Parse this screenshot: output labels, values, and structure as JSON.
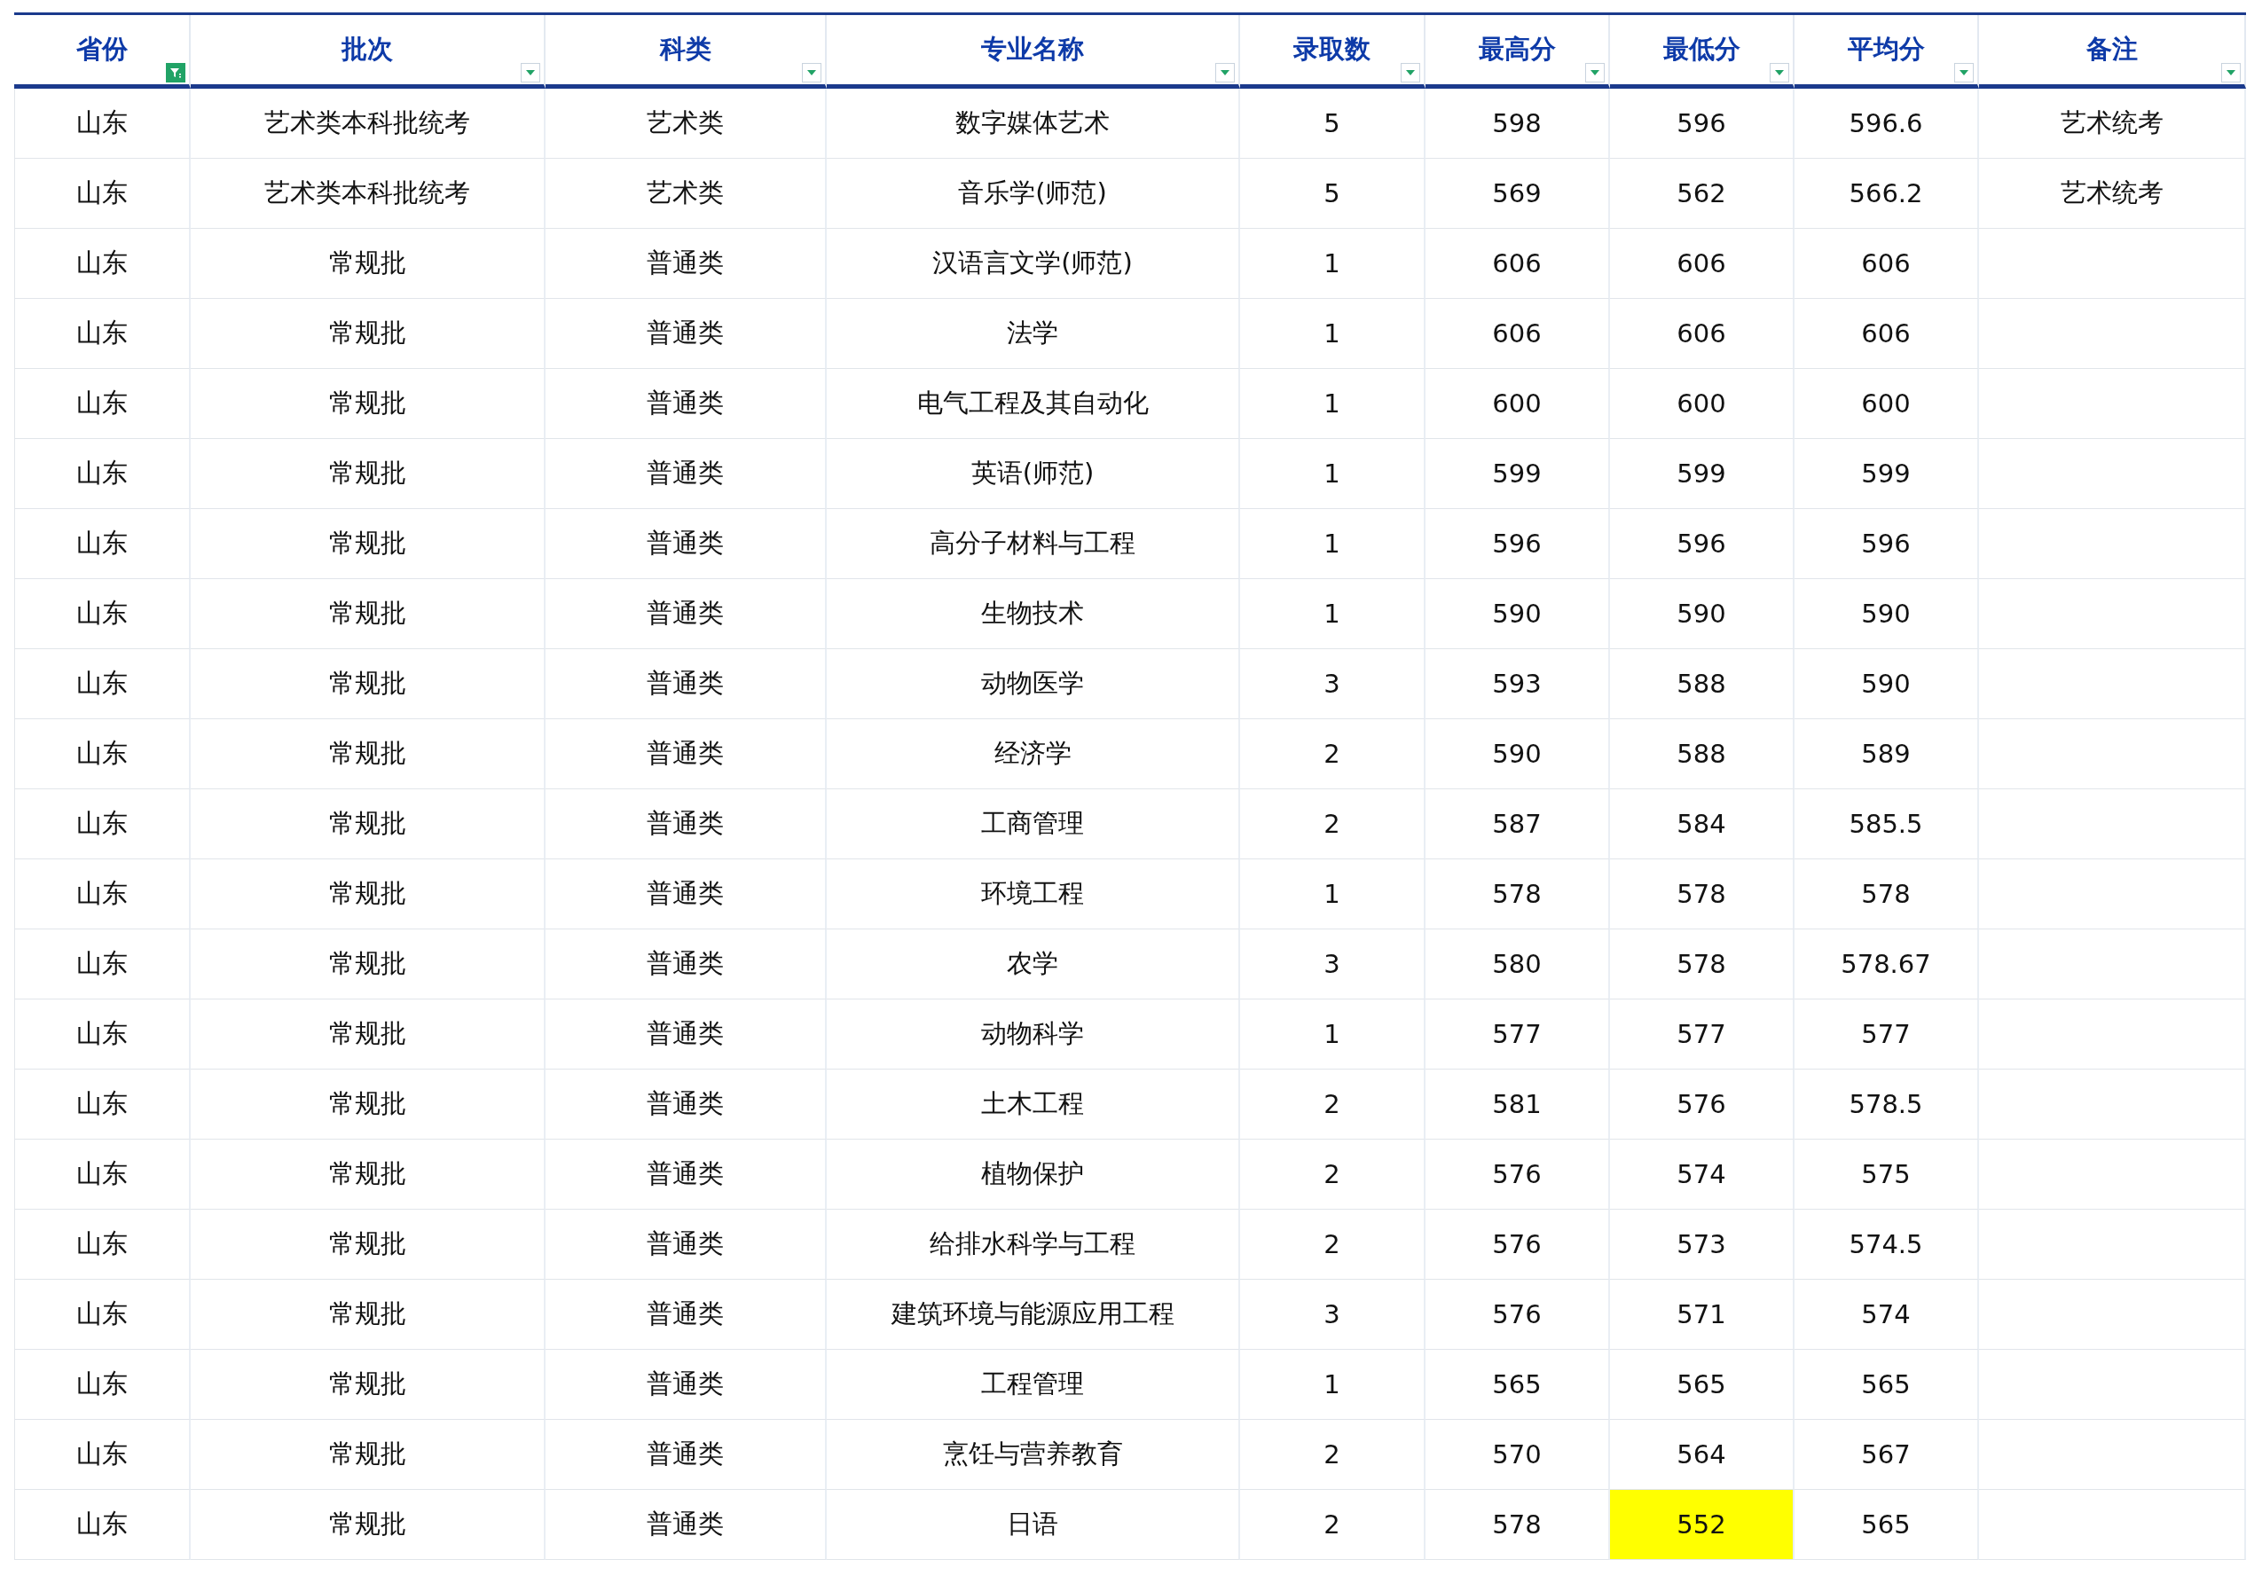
{
  "columns": [
    {
      "label": "省份",
      "filtered": true
    },
    {
      "label": "批次",
      "filtered": false
    },
    {
      "label": "科类",
      "filtered": false
    },
    {
      "label": "专业名称",
      "filtered": false
    },
    {
      "label": "录取数",
      "filtered": false
    },
    {
      "label": "最高分",
      "filtered": false
    },
    {
      "label": "最低分",
      "filtered": false
    },
    {
      "label": "平均分",
      "filtered": false
    },
    {
      "label": "备注",
      "filtered": false
    }
  ],
  "rows": [
    {
      "cells": [
        {
          "text": "山东",
          "highlighted": false
        },
        {
          "text": "艺术类本科批统考",
          "highlighted": false
        },
        {
          "text": "艺术类",
          "highlighted": false
        },
        {
          "text": "数字媒体艺术",
          "highlighted": false
        },
        {
          "text": "5",
          "highlighted": false
        },
        {
          "text": "598",
          "highlighted": false
        },
        {
          "text": "596",
          "highlighted": false
        },
        {
          "text": "596.6",
          "highlighted": false
        },
        {
          "text": "艺术统考",
          "highlighted": false
        }
      ]
    },
    {
      "cells": [
        {
          "text": "山东",
          "highlighted": false
        },
        {
          "text": "艺术类本科批统考",
          "highlighted": false
        },
        {
          "text": "艺术类",
          "highlighted": false
        },
        {
          "text": "音乐学(师范)",
          "highlighted": false
        },
        {
          "text": "5",
          "highlighted": false
        },
        {
          "text": "569",
          "highlighted": false
        },
        {
          "text": "562",
          "highlighted": false
        },
        {
          "text": "566.2",
          "highlighted": false
        },
        {
          "text": "艺术统考",
          "highlighted": false
        }
      ]
    },
    {
      "cells": [
        {
          "text": "山东",
          "highlighted": false
        },
        {
          "text": "常规批",
          "highlighted": false
        },
        {
          "text": "普通类",
          "highlighted": false
        },
        {
          "text": "汉语言文学(师范)",
          "highlighted": false
        },
        {
          "text": "1",
          "highlighted": false
        },
        {
          "text": "606",
          "highlighted": false
        },
        {
          "text": "606",
          "highlighted": false
        },
        {
          "text": "606",
          "highlighted": false
        }
      ]
    },
    {
      "cells": [
        {
          "text": "山东",
          "highlighted": false
        },
        {
          "text": "常规批",
          "highlighted": false
        },
        {
          "text": "普通类",
          "highlighted": false
        },
        {
          "text": "法学",
          "highlighted": false
        },
        {
          "text": "1",
          "highlighted": false
        },
        {
          "text": "606",
          "highlighted": false
        },
        {
          "text": "606",
          "highlighted": false
        },
        {
          "text": "606",
          "highlighted": false
        }
      ]
    },
    {
      "cells": [
        {
          "text": "山东",
          "highlighted": false
        },
        {
          "text": "常规批",
          "highlighted": false
        },
        {
          "text": "普通类",
          "highlighted": false
        },
        {
          "text": "电气工程及其自动化",
          "highlighted": false
        },
        {
          "text": "1",
          "highlighted": false
        },
        {
          "text": "600",
          "highlighted": false
        },
        {
          "text": "600",
          "highlighted": false
        },
        {
          "text": "600",
          "highlighted": false
        }
      ]
    },
    {
      "cells": [
        {
          "text": "山东",
          "highlighted": false
        },
        {
          "text": "常规批",
          "highlighted": false
        },
        {
          "text": "普通类",
          "highlighted": false
        },
        {
          "text": "英语(师范)",
          "highlighted": false
        },
        {
          "text": "1",
          "highlighted": false
        },
        {
          "text": "599",
          "highlighted": false
        },
        {
          "text": "599",
          "highlighted": false
        },
        {
          "text": "599",
          "highlighted": false
        }
      ]
    },
    {
      "cells": [
        {
          "text": "山东",
          "highlighted": false
        },
        {
          "text": "常规批",
          "highlighted": false
        },
        {
          "text": "普通类",
          "highlighted": false
        },
        {
          "text": "高分子材料与工程",
          "highlighted": false
        },
        {
          "text": "1",
          "highlighted": false
        },
        {
          "text": "596",
          "highlighted": false
        },
        {
          "text": "596",
          "highlighted": false
        },
        {
          "text": "596",
          "highlighted": false
        }
      ]
    },
    {
      "cells": [
        {
          "text": "山东",
          "highlighted": false
        },
        {
          "text": "常规批",
          "highlighted": false
        },
        {
          "text": "普通类",
          "highlighted": false
        },
        {
          "text": "生物技术",
          "highlighted": false
        },
        {
          "text": "1",
          "highlighted": false
        },
        {
          "text": "590",
          "highlighted": false
        },
        {
          "text": "590",
          "highlighted": false
        },
        {
          "text": "590",
          "highlighted": false
        }
      ]
    },
    {
      "cells": [
        {
          "text": "山东",
          "highlighted": false
        },
        {
          "text": "常规批",
          "highlighted": false
        },
        {
          "text": "普通类",
          "highlighted": false
        },
        {
          "text": "动物医学",
          "highlighted": false
        },
        {
          "text": "3",
          "highlighted": false
        },
        {
          "text": "593",
          "highlighted": false
        },
        {
          "text": "588",
          "highlighted": false
        },
        {
          "text": "590",
          "highlighted": false
        }
      ]
    },
    {
      "cells": [
        {
          "text": "山东",
          "highlighted": false
        },
        {
          "text": "常规批",
          "highlighted": false
        },
        {
          "text": "普通类",
          "highlighted": false
        },
        {
          "text": "经济学",
          "highlighted": false
        },
        {
          "text": "2",
          "highlighted": false
        },
        {
          "text": "590",
          "highlighted": false
        },
        {
          "text": "588",
          "highlighted": false
        },
        {
          "text": "589",
          "highlighted": false
        }
      ]
    },
    {
      "cells": [
        {
          "text": "山东",
          "highlighted": false
        },
        {
          "text": "常规批",
          "highlighted": false
        },
        {
          "text": "普通类",
          "highlighted": false
        },
        {
          "text": "工商管理",
          "highlighted": false
        },
        {
          "text": "2",
          "highlighted": false
        },
        {
          "text": "587",
          "highlighted": false
        },
        {
          "text": "584",
          "highlighted": false
        },
        {
          "text": "585.5",
          "highlighted": false
        }
      ]
    },
    {
      "cells": [
        {
          "text": "山东",
          "highlighted": false
        },
        {
          "text": "常规批",
          "highlighted": false
        },
        {
          "text": "普通类",
          "highlighted": false
        },
        {
          "text": "环境工程",
          "highlighted": false
        },
        {
          "text": "1",
          "highlighted": false
        },
        {
          "text": "578",
          "highlighted": false
        },
        {
          "text": "578",
          "highlighted": false
        },
        {
          "text": "578",
          "highlighted": false
        }
      ]
    },
    {
      "cells": [
        {
          "text": "山东",
          "highlighted": false
        },
        {
          "text": "常规批",
          "highlighted": false
        },
        {
          "text": "普通类",
          "highlighted": false
        },
        {
          "text": "农学",
          "highlighted": false
        },
        {
          "text": "3",
          "highlighted": false
        },
        {
          "text": "580",
          "highlighted": false
        },
        {
          "text": "578",
          "highlighted": false
        },
        {
          "text": "578.67",
          "highlighted": false
        }
      ]
    },
    {
      "cells": [
        {
          "text": "山东",
          "highlighted": false
        },
        {
          "text": "常规批",
          "highlighted": false
        },
        {
          "text": "普通类",
          "highlighted": false
        },
        {
          "text": "动物科学",
          "highlighted": false
        },
        {
          "text": "1",
          "highlighted": false
        },
        {
          "text": "577",
          "highlighted": false
        },
        {
          "text": "577",
          "highlighted": false
        },
        {
          "text": "577",
          "highlighted": false
        }
      ]
    },
    {
      "cells": [
        {
          "text": "山东",
          "highlighted": false
        },
        {
          "text": "常规批",
          "highlighted": false
        },
        {
          "text": "普通类",
          "highlighted": false
        },
        {
          "text": "土木工程",
          "highlighted": false
        },
        {
          "text": "2",
          "highlighted": false
        },
        {
          "text": "581",
          "highlighted": false
        },
        {
          "text": "576",
          "highlighted": false
        },
        {
          "text": "578.5",
          "highlighted": false
        }
      ]
    },
    {
      "cells": [
        {
          "text": "山东",
          "highlighted": false
        },
        {
          "text": "常规批",
          "highlighted": false
        },
        {
          "text": "普通类",
          "highlighted": false
        },
        {
          "text": "植物保护",
          "highlighted": false
        },
        {
          "text": "2",
          "highlighted": false
        },
        {
          "text": "576",
          "highlighted": false
        },
        {
          "text": "574",
          "highlighted": false
        },
        {
          "text": "575",
          "highlighted": false
        }
      ]
    },
    {
      "cells": [
        {
          "text": "山东",
          "highlighted": false
        },
        {
          "text": "常规批",
          "highlighted": false
        },
        {
          "text": "普通类",
          "highlighted": false
        },
        {
          "text": "给排水科学与工程",
          "highlighted": false
        },
        {
          "text": "2",
          "highlighted": false
        },
        {
          "text": "576",
          "highlighted": false
        },
        {
          "text": "573",
          "highlighted": false
        },
        {
          "text": "574.5",
          "highlighted": false
        }
      ]
    },
    {
      "cells": [
        {
          "text": "山东",
          "highlighted": false
        },
        {
          "text": "常规批",
          "highlighted": false
        },
        {
          "text": "普通类",
          "highlighted": false
        },
        {
          "text": "建筑环境与能源应用工程",
          "highlighted": false
        },
        {
          "text": "3",
          "highlighted": false
        },
        {
          "text": "576",
          "highlighted": false
        },
        {
          "text": "571",
          "highlighted": false
        },
        {
          "text": "574",
          "highlighted": false
        }
      ]
    },
    {
      "cells": [
        {
          "text": "山东",
          "highlighted": false
        },
        {
          "text": "常规批",
          "highlighted": false
        },
        {
          "text": "普通类",
          "highlighted": false
        },
        {
          "text": "工程管理",
          "highlighted": false
        },
        {
          "text": "1",
          "highlighted": false
        },
        {
          "text": "565",
          "highlighted": false
        },
        {
          "text": "565",
          "highlighted": false
        },
        {
          "text": "565",
          "highlighted": false
        }
      ]
    },
    {
      "cells": [
        {
          "text": "山东",
          "highlighted": false
        },
        {
          "text": "常规批",
          "highlighted": false
        },
        {
          "text": "普通类",
          "highlighted": false
        },
        {
          "text": "烹饪与营养教育",
          "highlighted": false
        },
        {
          "text": "2",
          "highlighted": false
        },
        {
          "text": "570",
          "highlighted": false
        },
        {
          "text": "564",
          "highlighted": false
        },
        {
          "text": "567",
          "highlighted": false
        }
      ]
    },
    {
      "cells": [
        {
          "text": "山东",
          "highlighted": false
        },
        {
          "text": "常规批",
          "highlighted": false
        },
        {
          "text": "普通类",
          "highlighted": false
        },
        {
          "text": "日语",
          "highlighted": false
        },
        {
          "text": "2",
          "highlighted": false
        },
        {
          "text": "578",
          "highlighted": false
        },
        {
          "text": "552",
          "highlighted": true
        },
        {
          "text": "565",
          "highlighted": false
        }
      ]
    }
  ]
}
